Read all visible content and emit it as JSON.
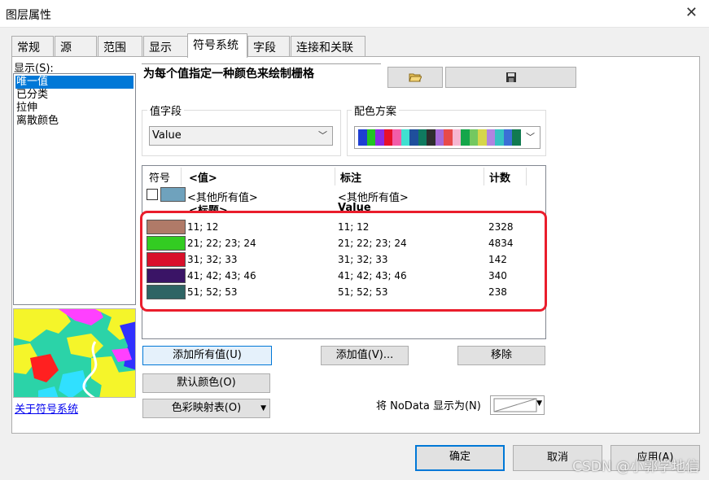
{
  "window": {
    "title": "图层属性",
    "close_symbol": "✕"
  },
  "tabs": [
    {
      "label": "常规"
    },
    {
      "label": "源"
    },
    {
      "label": "范围"
    },
    {
      "label": "显示"
    },
    {
      "label": "符号系统",
      "active": true
    },
    {
      "label": "字段"
    },
    {
      "label": "连接和关联"
    }
  ],
  "show": {
    "label": "显示(S):",
    "items": [
      {
        "label": "唯一值",
        "selected": true
      },
      {
        "label": "已分类"
      },
      {
        "label": "拉伸"
      },
      {
        "label": "离散颜色"
      }
    ]
  },
  "about_link": "关于符号系统",
  "description": "为每个值指定一种颜色来绘制栅格",
  "value_field": {
    "label": "值字段",
    "value": "Value"
  },
  "color_scheme": {
    "label": "配色方案",
    "colors": [
      "#1e3fd2",
      "#22c422",
      "#8a2be2",
      "#e8102a",
      "#f25ca8",
      "#40e0d0",
      "#1f4f9c",
      "#0f7a5f",
      "#2e2e2e",
      "#a66ad8",
      "#e84a4a",
      "#f6b6d1",
      "#15a64a",
      "#74c860",
      "#d6d64a",
      "#b084e0",
      "#36c2c2",
      "#3b6fd6",
      "#117a50"
    ]
  },
  "table": {
    "headers": {
      "symbol": "符号",
      "value": "<值>",
      "label": "标注",
      "count": "计数"
    },
    "other": {
      "value": "<其他所有值>",
      "label": "<其他所有值>",
      "color": "#6fa2bd"
    },
    "heading_row": {
      "value": "<标题>",
      "label": "Value"
    },
    "rows": [
      {
        "value": "11; 12",
        "label": "11; 12",
        "count": "2328",
        "color": "#b07a68"
      },
      {
        "value": "21; 22; 23; 24",
        "label": "21; 22; 23; 24",
        "count": "4834",
        "color": "#33cc22"
      },
      {
        "value": "31; 32; 33",
        "label": "31; 32; 33",
        "count": "142",
        "color": "#d8102a"
      },
      {
        "value": "41; 42; 43; 46",
        "label": "41; 42; 43; 46",
        "count": "340",
        "color": "#3a1466"
      },
      {
        "value": "51; 52; 53",
        "label": "51; 52; 53",
        "count": "238",
        "color": "#2e6464"
      }
    ]
  },
  "buttons": {
    "add_all": "添加所有值(U)",
    "add": "添加值(V)...",
    "remove": "移除",
    "default_colors": "默认颜色(O)",
    "colormap": "色彩映射表(O)",
    "ok": "确定",
    "cancel": "取消",
    "apply": "应用(A)"
  },
  "nodata": {
    "label": "将 NoData 显示为(N)"
  },
  "watermark": "CSDN @小郭学地信"
}
